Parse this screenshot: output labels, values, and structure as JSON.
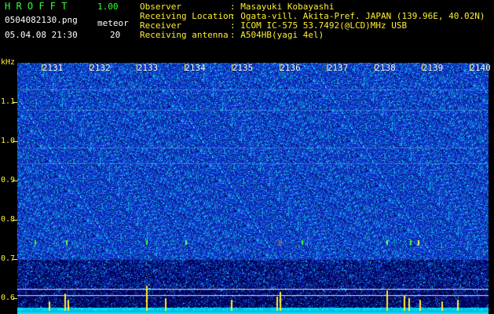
{
  "app": {
    "name": "H R O F F T",
    "version": "1.00"
  },
  "file": {
    "name": "0504082130.png",
    "datetime": "05.04.08 21:30"
  },
  "meteor": {
    "label": "meteor",
    "count": "20"
  },
  "info": [
    {
      "label": "Observer",
      "value": ": Masayuki Kobayashi"
    },
    {
      "label": "Receiving Location",
      "value": ": Ogata-vill. Akita-Pref. JAPAN (139.96E, 40.02N)"
    },
    {
      "label": "Receiver",
      "value": ": ICOM IC-575 53.7492(@LCD)MHz USB"
    },
    {
      "label": "Receiving antenna",
      "value": ": A504HB(yagi 4el)"
    }
  ],
  "axis": {
    "unit": "kHz",
    "freq_ticks": [
      {
        "label": "1.1",
        "khz": 1.1
      },
      {
        "label": "1.0",
        "khz": 1.0
      },
      {
        "label": "0.9",
        "khz": 0.9
      },
      {
        "label": "0.8",
        "khz": 0.8
      },
      {
        "label": "0.7",
        "khz": 0.7
      },
      {
        "label": "0.6",
        "khz": 0.6
      }
    ],
    "time_ticks": [
      "2131",
      "2132",
      "2133",
      "2134",
      "2135",
      "2136",
      "2137",
      "2138",
      "2139",
      "2140"
    ]
  },
  "colors": {
    "green": "#33ff33",
    "yellow": "#ffee33",
    "background": "#000000",
    "noise_blue": "#1a2bd0",
    "level_cyan": "#00e5ff"
  }
}
